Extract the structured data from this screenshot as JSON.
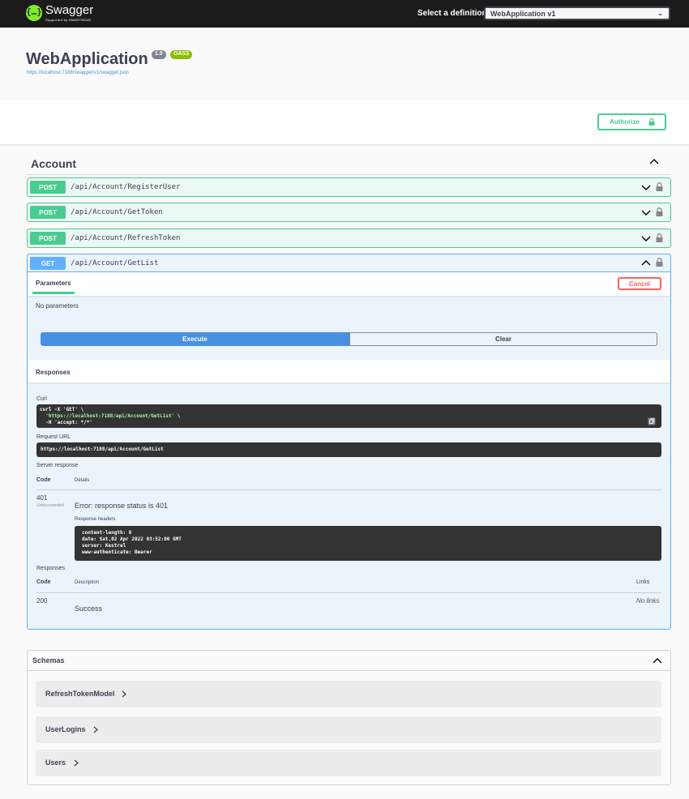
{
  "topbar": {
    "logo_name": "Swagger",
    "logo_sub": "Supported by SMARTBEAR",
    "definition_label": "Select a definition",
    "definition_value": "WebApplication v1"
  },
  "info": {
    "title": "WebApplication",
    "version": "1.0",
    "oas": "OAS3",
    "spec_url": "https://localhost:7188/swagger/v1/swagger.json"
  },
  "authorize_label": "Authorize",
  "tag": {
    "name": "Account"
  },
  "operations": [
    {
      "method": "POST",
      "path": "/api/Account/RegisterUser"
    },
    {
      "method": "POST",
      "path": "/api/Account/GetToken"
    },
    {
      "method": "POST",
      "path": "/api/Account/RefreshToken"
    },
    {
      "method": "GET",
      "path": "/api/Account/GetList"
    }
  ],
  "get_panel": {
    "params_tab": "Parameters",
    "cancel_label": "Cancel",
    "no_params": "No parameters",
    "execute_label": "Execute",
    "clear_label": "Clear",
    "responses_title": "Responses",
    "curl_label": "Curl",
    "curl_line1": "curl -X 'GET' \\",
    "curl_line2": "'https://localhost:7188/api/Account/GetList'",
    "curl_line3": "-H 'accept: */*'",
    "request_url_label": "Request URL",
    "request_url": "https://localhost:7188/api/Account/GetList",
    "server_response_label": "Server response",
    "code_header": "Code",
    "details_header": "Details",
    "response_code": "401",
    "undocumented": "Undocumented",
    "error_text": "Error: response status is 401",
    "response_headers_label": "Response headers",
    "headers_lines": [
      "content-length: 0",
      "date: Sat,02 Apr 2022 03:52:00 GMT",
      "server: Kestrel",
      "www-authenticate: Bearer"
    ],
    "responses_label": "Responses",
    "description_header": "Description",
    "links_header": "Links",
    "resp_code": "200",
    "resp_description": "Success",
    "resp_links": "No links"
  },
  "schemas": {
    "title": "Schemas",
    "models": [
      "RefreshTokenModel",
      "UserLogins",
      "Users"
    ]
  },
  "colors": {
    "post": "#49cc90",
    "get": "#61affe",
    "cancel": "#ff6060",
    "execute": "#4990e2",
    "topbar": "#1b1b1b"
  }
}
